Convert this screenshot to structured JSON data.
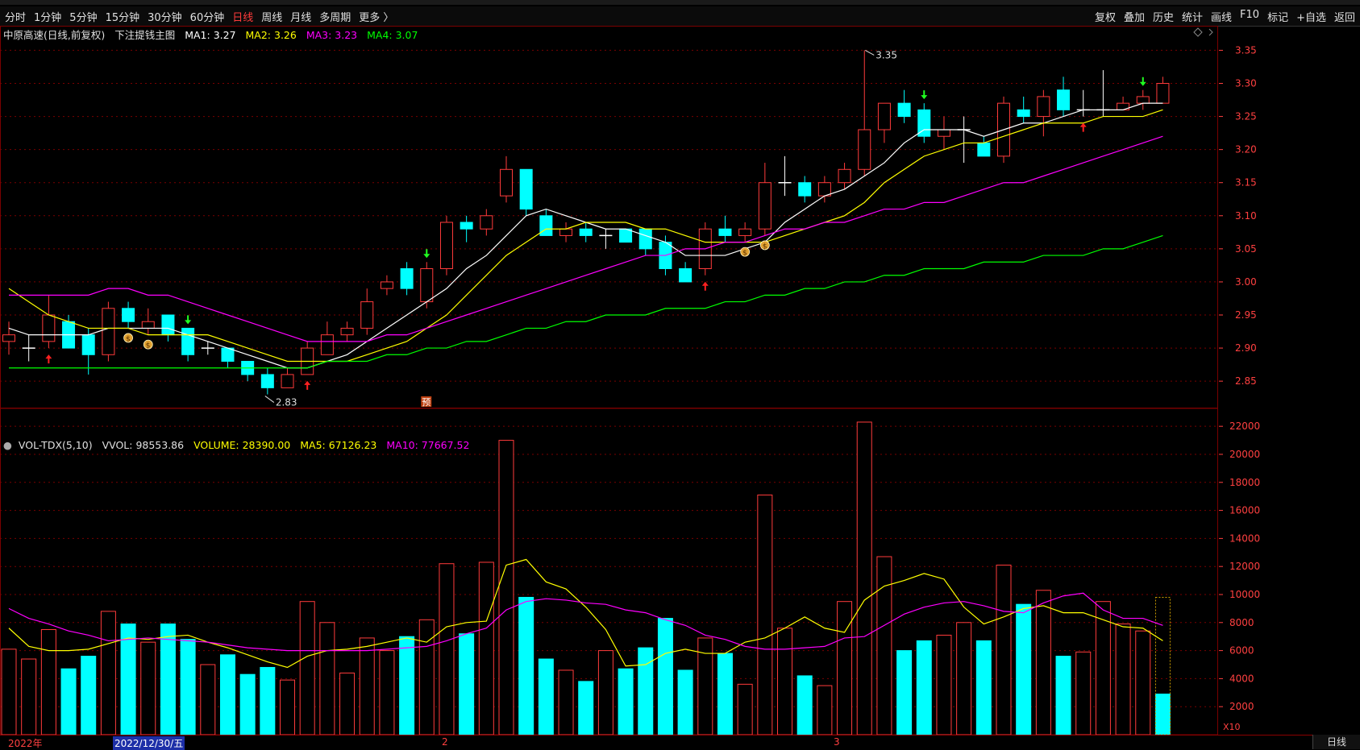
{
  "toolbar": {
    "periods": [
      "分时",
      "1分钟",
      "5分钟",
      "15分钟",
      "30分钟",
      "60分钟",
      "日线",
      "周线",
      "月线",
      "多周期",
      "更多 〉"
    ],
    "active_period": "日线",
    "actions": [
      "复权",
      "叠加",
      "历史",
      "统计",
      "画线",
      "F10",
      "标记",
      "+自选",
      "返回"
    ]
  },
  "main_panel": {
    "stock": "中原高速(日线,前复权)",
    "formula": "下注提钱主图",
    "ma1_label": "MA1: 3.27",
    "ma2_label": "MA2: 3.26",
    "ma3_label": "MA3: 3.23",
    "ma4_label": "MA4: 3.07",
    "high_marker": "3.35",
    "low_marker": "2.83",
    "forecast_badge": "预"
  },
  "vol_panel": {
    "name": "VOL-TDX(5,10)",
    "vvol": "VVOL: 98553.86",
    "volume": "VOLUME: 28390.00",
    "ma5": "MA5: 67126.23",
    "ma10": "MA10: 77667.52",
    "unit": "X10"
  },
  "footer": {
    "year_label": "2022年",
    "cursor_date": "2022/12/30/五",
    "month2": "2",
    "month3": "3",
    "period": "日线"
  },
  "colors": {
    "up": "#ff3b3b",
    "down": "#00ffff",
    "ma1": "#ffffff",
    "ma2": "#ffff00",
    "ma3": "#ff00ff",
    "ma4": "#00ff00",
    "grid": "#7a0000",
    "axis_text": "#ff4040"
  },
  "chart_data": [
    {
      "type": "candlestick",
      "title": "中原高速(日线,前复权)",
      "y_ticks": [
        3.35,
        3.3,
        3.25,
        3.2,
        3.15,
        3.1,
        3.05,
        3.0,
        2.95,
        2.9,
        2.85
      ],
      "ylim": [
        2.81,
        3.37
      ],
      "candles": [
        {
          "o": 2.91,
          "c": 2.92,
          "h": 2.94,
          "l": 2.89
        },
        {
          "o": 2.9,
          "c": 2.9,
          "h": 2.92,
          "l": 2.88
        },
        {
          "o": 2.91,
          "c": 2.95,
          "h": 2.98,
          "l": 2.9
        },
        {
          "o": 2.94,
          "c": 2.9,
          "h": 2.95,
          "l": 2.9
        },
        {
          "o": 2.92,
          "c": 2.89,
          "h": 2.93,
          "l": 2.86
        },
        {
          "o": 2.89,
          "c": 2.96,
          "h": 2.97,
          "l": 2.88
        },
        {
          "o": 2.96,
          "c": 2.94,
          "h": 2.97,
          "l": 2.93
        },
        {
          "o": 2.93,
          "c": 2.94,
          "h": 2.96,
          "l": 2.92
        },
        {
          "o": 2.95,
          "c": 2.92,
          "h": 2.95,
          "l": 2.91
        },
        {
          "o": 2.93,
          "c": 2.89,
          "h": 2.93,
          "l": 2.88
        },
        {
          "o": 2.9,
          "c": 2.9,
          "h": 2.91,
          "l": 2.89
        },
        {
          "o": 2.9,
          "c": 2.88,
          "h": 2.9,
          "l": 2.87
        },
        {
          "o": 2.88,
          "c": 2.86,
          "h": 2.88,
          "l": 2.85
        },
        {
          "o": 2.86,
          "c": 2.84,
          "h": 2.87,
          "l": 2.83
        },
        {
          "o": 2.84,
          "c": 2.86,
          "h": 2.87,
          "l": 2.84
        },
        {
          "o": 2.86,
          "c": 2.9,
          "h": 2.91,
          "l": 2.86
        },
        {
          "o": 2.89,
          "c": 2.92,
          "h": 2.94,
          "l": 2.89
        },
        {
          "o": 2.92,
          "c": 2.93,
          "h": 2.94,
          "l": 2.91
        },
        {
          "o": 2.93,
          "c": 2.97,
          "h": 2.99,
          "l": 2.92
        },
        {
          "o": 2.99,
          "c": 3.0,
          "h": 3.01,
          "l": 2.98
        },
        {
          "o": 3.02,
          "c": 2.99,
          "h": 3.03,
          "l": 2.98
        },
        {
          "o": 2.97,
          "c": 3.02,
          "h": 3.03,
          "l": 2.96
        },
        {
          "o": 3.02,
          "c": 3.09,
          "h": 3.1,
          "l": 3.01
        },
        {
          "o": 3.09,
          "c": 3.08,
          "h": 3.1,
          "l": 3.06
        },
        {
          "o": 3.08,
          "c": 3.1,
          "h": 3.11,
          "l": 3.07
        },
        {
          "o": 3.13,
          "c": 3.17,
          "h": 3.19,
          "l": 3.12
        },
        {
          "o": 3.17,
          "c": 3.11,
          "h": 3.17,
          "l": 3.1
        },
        {
          "o": 3.1,
          "c": 3.07,
          "h": 3.11,
          "l": 3.07
        },
        {
          "o": 3.07,
          "c": 3.08,
          "h": 3.09,
          "l": 3.06
        },
        {
          "o": 3.08,
          "c": 3.07,
          "h": 3.09,
          "l": 3.06
        },
        {
          "o": 3.07,
          "c": 3.07,
          "h": 3.08,
          "l": 3.05
        },
        {
          "o": 3.08,
          "c": 3.06,
          "h": 3.08,
          "l": 3.06
        },
        {
          "o": 3.08,
          "c": 3.05,
          "h": 3.08,
          "l": 3.04
        },
        {
          "o": 3.06,
          "c": 3.02,
          "h": 3.07,
          "l": 3.01
        },
        {
          "o": 3.02,
          "c": 3.0,
          "h": 3.03,
          "l": 3.0
        },
        {
          "o": 3.02,
          "c": 3.08,
          "h": 3.09,
          "l": 3.01
        },
        {
          "o": 3.08,
          "c": 3.07,
          "h": 3.1,
          "l": 3.06
        },
        {
          "o": 3.07,
          "c": 3.08,
          "h": 3.09,
          "l": 3.06
        },
        {
          "o": 3.08,
          "c": 3.15,
          "h": 3.18,
          "l": 3.07
        },
        {
          "o": 3.15,
          "c": 3.15,
          "h": 3.19,
          "l": 3.13
        },
        {
          "o": 3.15,
          "c": 3.13,
          "h": 3.16,
          "l": 3.12
        },
        {
          "o": 3.13,
          "c": 3.15,
          "h": 3.16,
          "l": 3.12
        },
        {
          "o": 3.15,
          "c": 3.17,
          "h": 3.18,
          "l": 3.14
        },
        {
          "o": 3.17,
          "c": 3.23,
          "h": 3.35,
          "l": 3.16
        },
        {
          "o": 3.23,
          "c": 3.27,
          "h": 3.27,
          "l": 3.21
        },
        {
          "o": 3.27,
          "c": 3.25,
          "h": 3.29,
          "l": 3.24
        },
        {
          "o": 3.26,
          "c": 3.22,
          "h": 3.27,
          "l": 3.21
        },
        {
          "o": 3.22,
          "c": 3.23,
          "h": 3.25,
          "l": 3.2
        },
        {
          "o": 3.23,
          "c": 3.23,
          "h": 3.25,
          "l": 3.18
        },
        {
          "o": 3.21,
          "c": 3.19,
          "h": 3.22,
          "l": 3.19
        },
        {
          "o": 3.19,
          "c": 3.27,
          "h": 3.28,
          "l": 3.18
        },
        {
          "o": 3.26,
          "c": 3.25,
          "h": 3.28,
          "l": 3.24
        },
        {
          "o": 3.25,
          "c": 3.28,
          "h": 3.29,
          "l": 3.22
        },
        {
          "o": 3.29,
          "c": 3.26,
          "h": 3.31,
          "l": 3.25
        },
        {
          "o": 3.26,
          "c": 3.26,
          "h": 3.29,
          "l": 3.25
        },
        {
          "o": 3.26,
          "c": 3.26,
          "h": 3.32,
          "l": 3.25
        },
        {
          "o": 3.26,
          "c": 3.27,
          "h": 3.28,
          "l": 3.26
        },
        {
          "o": 3.27,
          "c": 3.28,
          "h": 3.29,
          "l": 3.26
        },
        {
          "o": 3.27,
          "c": 3.3,
          "h": 3.31,
          "l": 3.27
        }
      ],
      "series": [
        {
          "name": "MA1",
          "values": [
            2.93,
            2.92,
            2.92,
            2.92,
            2.92,
            2.93,
            2.93,
            2.93,
            2.93,
            2.92,
            2.91,
            2.9,
            2.89,
            2.88,
            2.87,
            2.87,
            2.88,
            2.89,
            2.91,
            2.93,
            2.95,
            2.97,
            2.99,
            3.02,
            3.04,
            3.07,
            3.1,
            3.11,
            3.1,
            3.09,
            3.08,
            3.08,
            3.07,
            3.06,
            3.04,
            3.04,
            3.04,
            3.05,
            3.06,
            3.09,
            3.11,
            3.13,
            3.14,
            3.16,
            3.18,
            3.21,
            3.23,
            3.23,
            3.23,
            3.22,
            3.23,
            3.24,
            3.24,
            3.25,
            3.26,
            3.26,
            3.26,
            3.27,
            3.27
          ]
        },
        {
          "name": "MA2",
          "values": [
            2.99,
            2.97,
            2.95,
            2.94,
            2.93,
            2.93,
            2.93,
            2.92,
            2.92,
            2.92,
            2.92,
            2.91,
            2.9,
            2.89,
            2.88,
            2.88,
            2.88,
            2.88,
            2.89,
            2.9,
            2.91,
            2.93,
            2.95,
            2.98,
            3.01,
            3.04,
            3.06,
            3.08,
            3.08,
            3.09,
            3.09,
            3.09,
            3.08,
            3.08,
            3.07,
            3.06,
            3.06,
            3.06,
            3.06,
            3.07,
            3.08,
            3.09,
            3.1,
            3.12,
            3.15,
            3.17,
            3.19,
            3.2,
            3.21,
            3.21,
            3.22,
            3.23,
            3.24,
            3.24,
            3.24,
            3.25,
            3.25,
            3.25,
            3.26
          ]
        },
        {
          "name": "MA3",
          "values": [
            2.98,
            2.98,
            2.98,
            2.98,
            2.98,
            2.99,
            2.99,
            2.98,
            2.98,
            2.97,
            2.96,
            2.95,
            2.94,
            2.93,
            2.92,
            2.91,
            2.91,
            2.91,
            2.91,
            2.92,
            2.92,
            2.93,
            2.94,
            2.95,
            2.96,
            2.97,
            2.98,
            2.99,
            3.0,
            3.01,
            3.02,
            3.03,
            3.04,
            3.04,
            3.05,
            3.05,
            3.06,
            3.06,
            3.07,
            3.08,
            3.08,
            3.09,
            3.09,
            3.1,
            3.11,
            3.11,
            3.12,
            3.12,
            3.13,
            3.14,
            3.15,
            3.15,
            3.16,
            3.17,
            3.18,
            3.19,
            3.2,
            3.21,
            3.22
          ]
        },
        {
          "name": "MA4",
          "values": [
            2.87,
            2.87,
            2.87,
            2.87,
            2.87,
            2.87,
            2.87,
            2.87,
            2.87,
            2.87,
            2.87,
            2.87,
            2.87,
            2.87,
            2.87,
            2.87,
            2.88,
            2.88,
            2.88,
            2.89,
            2.89,
            2.9,
            2.9,
            2.91,
            2.91,
            2.92,
            2.93,
            2.93,
            2.94,
            2.94,
            2.95,
            2.95,
            2.95,
            2.96,
            2.96,
            2.96,
            2.97,
            2.97,
            2.98,
            2.98,
            2.99,
            2.99,
            3.0,
            3.0,
            3.01,
            3.01,
            3.02,
            3.02,
            3.02,
            3.03,
            3.03,
            3.03,
            3.04,
            3.04,
            3.04,
            3.05,
            3.05,
            3.06,
            3.07
          ]
        }
      ],
      "up_arrows": [
        2,
        15,
        35,
        54
      ],
      "down_arrows": [
        9,
        21,
        46,
        57
      ],
      "coin_markers": [
        6,
        7,
        37,
        38
      ]
    },
    {
      "type": "bar",
      "title": "VOL-TDX(5,10)",
      "y_ticks": [
        22000,
        20000,
        18000,
        16000,
        14000,
        12000,
        10000,
        8000,
        6000,
        4000,
        2000
      ],
      "ylim": [
        0,
        22700
      ],
      "volumes": [
        6100,
        5400,
        7500,
        4700,
        5600,
        8800,
        7900,
        6600,
        7900,
        6800,
        5000,
        5700,
        4300,
        4800,
        3900,
        9500,
        8000,
        4400,
        6900,
        6000,
        7000,
        8200,
        12200,
        7200,
        12300,
        21000,
        9800,
        5400,
        4600,
        3800,
        6000,
        4700,
        6200,
        8300,
        4600,
        6900,
        5800,
        3600,
        17100,
        7600,
        4200,
        3500,
        9500,
        22300,
        12700,
        6000,
        6700,
        7100,
        8000,
        6700,
        12100,
        9300,
        10300,
        5600,
        5900,
        9500,
        7900,
        7400,
        2900
      ],
      "ma5": [
        7600,
        6300,
        6000,
        6000,
        6100,
        6500,
        6900,
        6800,
        7000,
        7100,
        6600,
        6200,
        5700,
        5200,
        4800,
        5600,
        6000,
        6100,
        6300,
        6600,
        6900,
        6600,
        7700,
        8000,
        8100,
        12100,
        12500,
        10900,
        10400,
        9100,
        7500,
        4900,
        5000,
        5800,
        6100,
        5800,
        5800,
        6600,
        6900,
        7600,
        8400,
        7600,
        7300,
        9600,
        10600,
        11000,
        11500,
        11100,
        9100,
        7900,
        8400,
        9000,
        9200,
        8700,
        8700,
        8200,
        7700,
        7600,
        6700
      ],
      "ma10": [
        9000,
        8300,
        7900,
        7400,
        7100,
        6700,
        6800,
        6900,
        6800,
        6700,
        6600,
        6400,
        6200,
        6100,
        6000,
        6000,
        6000,
        6000,
        6000,
        6100,
        6200,
        6300,
        6700,
        7200,
        7600,
        8900,
        9500,
        9700,
        9600,
        9400,
        9300,
        8900,
        8700,
        8200,
        7800,
        7100,
        6800,
        6300,
        6100,
        6100,
        6200,
        6300,
        6900,
        7000,
        7800,
        8600,
        9100,
        9400,
        9500,
        9200,
        8800,
        8700,
        9400,
        9900,
        10100,
        8900,
        8300,
        8300,
        7800
      ]
    }
  ]
}
